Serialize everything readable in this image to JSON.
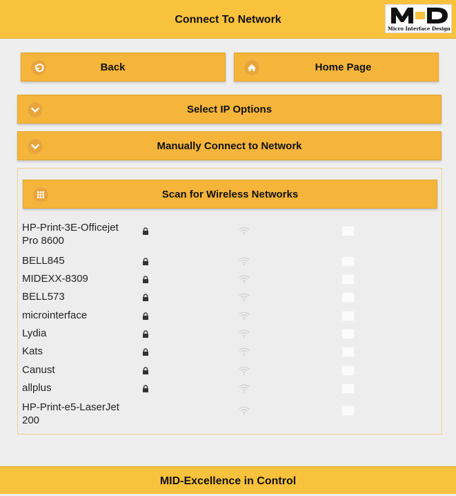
{
  "header": {
    "title": "Connect To Network",
    "logo_mark": "MiD",
    "logo_text": "Micro Interface Design"
  },
  "buttons": {
    "back": {
      "label": "Back",
      "icon": "back-arrow-icon"
    },
    "home": {
      "label": "Home Page",
      "icon": "home-icon"
    },
    "select_ip": {
      "label": "Select IP Options",
      "icon": "chevron-down-icon"
    },
    "manual": {
      "label": "Manually Connect to Network",
      "icon": "chevron-down-icon"
    },
    "scan": {
      "label": "Scan for Wireless Networks",
      "icon": "grid-icon"
    }
  },
  "networks": [
    {
      "name": "HP-Print-3E-Officejet Pro 8600",
      "secured": true
    },
    {
      "name": "BELL845",
      "secured": true
    },
    {
      "name": "MIDEXX-8309",
      "secured": true
    },
    {
      "name": "BELL573",
      "secured": true
    },
    {
      "name": "microinterface",
      "secured": true
    },
    {
      "name": "Lydia",
      "secured": true
    },
    {
      "name": "Kats",
      "secured": true
    },
    {
      "name": "Canust",
      "secured": true
    },
    {
      "name": "allplus",
      "secured": true
    },
    {
      "name": "HP-Print-e5-LaserJet 200",
      "secured": false
    }
  ],
  "footer": {
    "text": "MID-Excellence in Control"
  },
  "colors": {
    "accent": "#f9c23c",
    "button": "#f5b43a",
    "background": "#eeeeee"
  }
}
